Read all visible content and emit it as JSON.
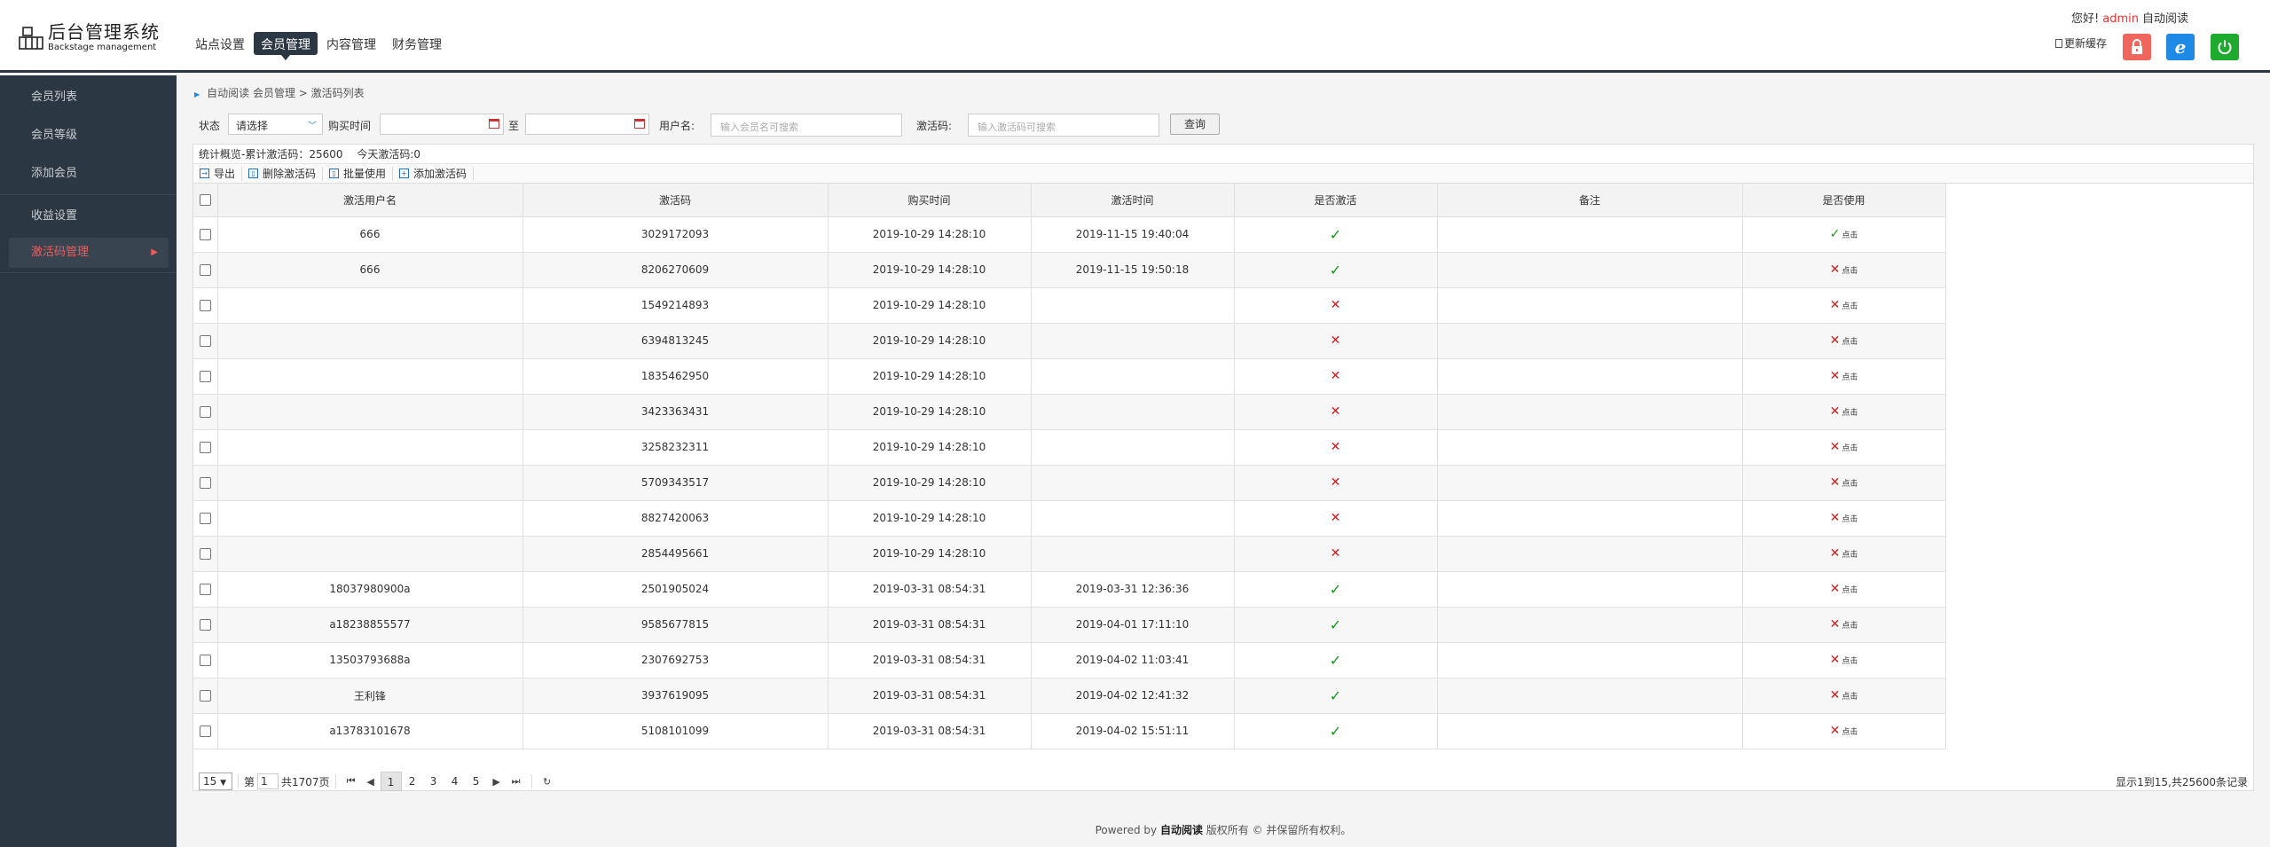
{
  "header": {
    "logo_title": "后台管理系统",
    "logo_sub": "Backstage management",
    "nav": [
      {
        "label": "站点设置",
        "active": false
      },
      {
        "label": "会员管理",
        "active": true
      },
      {
        "label": "内容管理",
        "active": false
      },
      {
        "label": "财务管理",
        "active": false
      }
    ],
    "greeting": "您好!",
    "user": "admin",
    "site": "自动阅读",
    "refresh_cache": "更新缓存"
  },
  "sidebar": {
    "items": [
      {
        "label": "会员列表",
        "active": false
      },
      {
        "label": "会员等级",
        "active": false
      },
      {
        "label": "添加会员",
        "active": false
      },
      {
        "label": "收益设置",
        "active": false
      },
      {
        "label": "激活码管理",
        "active": true
      }
    ]
  },
  "breadcrumb": "自动阅读 会员管理 > 激活码列表",
  "search": {
    "status_label": "状态",
    "status_value": "请选择",
    "buy_time_label": "购买时间",
    "to_label": "至",
    "username_label": "用户名:",
    "username_placeholder": "输入会员名可搜索",
    "code_label": "激活码:",
    "code_placeholder": "输入激活码可搜索",
    "query_button": "查询"
  },
  "stats": {
    "summary": "统计概览-累计激活码：25600",
    "today": "今天激活码:0"
  },
  "toolbar": {
    "export": "导出",
    "delete": "删除激活码",
    "batch_use": "批量使用",
    "add": "添加激活码"
  },
  "table": {
    "columns": [
      "激活用户名",
      "激活码",
      "购买时间",
      "激活时间",
      "是否激活",
      "备注",
      "是否使用"
    ],
    "use_link": "点击",
    "rows": [
      {
        "user": "666",
        "code": "3029172093",
        "buy": "2019-10-29 14:28:10",
        "act": "2019-11-15 19:40:04",
        "activated": true,
        "note": "",
        "used": true
      },
      {
        "user": "666",
        "code": "8206270609",
        "buy": "2019-10-29 14:28:10",
        "act": "2019-11-15 19:50:18",
        "activated": true,
        "note": "",
        "used": false
      },
      {
        "user": "",
        "code": "1549214893",
        "buy": "2019-10-29 14:28:10",
        "act": "",
        "activated": false,
        "note": "",
        "used": false
      },
      {
        "user": "",
        "code": "6394813245",
        "buy": "2019-10-29 14:28:10",
        "act": "",
        "activated": false,
        "note": "",
        "used": false
      },
      {
        "user": "",
        "code": "1835462950",
        "buy": "2019-10-29 14:28:10",
        "act": "",
        "activated": false,
        "note": "",
        "used": false
      },
      {
        "user": "",
        "code": "3423363431",
        "buy": "2019-10-29 14:28:10",
        "act": "",
        "activated": false,
        "note": "",
        "used": false
      },
      {
        "user": "",
        "code": "3258232311",
        "buy": "2019-10-29 14:28:10",
        "act": "",
        "activated": false,
        "note": "",
        "used": false
      },
      {
        "user": "",
        "code": "5709343517",
        "buy": "2019-10-29 14:28:10",
        "act": "",
        "activated": false,
        "note": "",
        "used": false
      },
      {
        "user": "",
        "code": "8827420063",
        "buy": "2019-10-29 14:28:10",
        "act": "",
        "activated": false,
        "note": "",
        "used": false
      },
      {
        "user": "",
        "code": "2854495661",
        "buy": "2019-10-29 14:28:10",
        "act": "",
        "activated": false,
        "note": "",
        "used": false
      },
      {
        "user": "18037980900a",
        "code": "2501905024",
        "buy": "2019-03-31 08:54:31",
        "act": "2019-03-31 12:36:36",
        "activated": true,
        "note": "",
        "used": false
      },
      {
        "user": "a18238855577",
        "code": "9585677815",
        "buy": "2019-03-31 08:54:31",
        "act": "2019-04-01 17:11:10",
        "activated": true,
        "note": "",
        "used": false
      },
      {
        "user": "13503793688a",
        "code": "2307692753",
        "buy": "2019-03-31 08:54:31",
        "act": "2019-04-02 11:03:41",
        "activated": true,
        "note": "",
        "used": false
      },
      {
        "user": "王利锋",
        "code": "3937619095",
        "buy": "2019-03-31 08:54:31",
        "act": "2019-04-02 12:41:32",
        "activated": true,
        "note": "",
        "used": false
      },
      {
        "user": "a13783101678",
        "code": "5108101099",
        "buy": "2019-03-31 08:54:31",
        "act": "2019-04-02 15:51:11",
        "activated": true,
        "note": "",
        "used": false
      }
    ]
  },
  "pager": {
    "page_size": "15",
    "page_prefix": "第",
    "current_page": "1",
    "total_pages": "共1707页",
    "pages": [
      "1",
      "2",
      "3",
      "4",
      "5"
    ],
    "summary": "显示1到15,共25600条记录"
  },
  "footer": {
    "prefix": "Powered by",
    "brand": "自动阅读",
    "suffix": "版权所有 © 并保留所有权利。"
  },
  "colors": {
    "sidebar_bg": "#2b3743",
    "active_red": "#f05b5b",
    "check_green": "#1a9a1a",
    "cross_red": "#d81b1b"
  }
}
